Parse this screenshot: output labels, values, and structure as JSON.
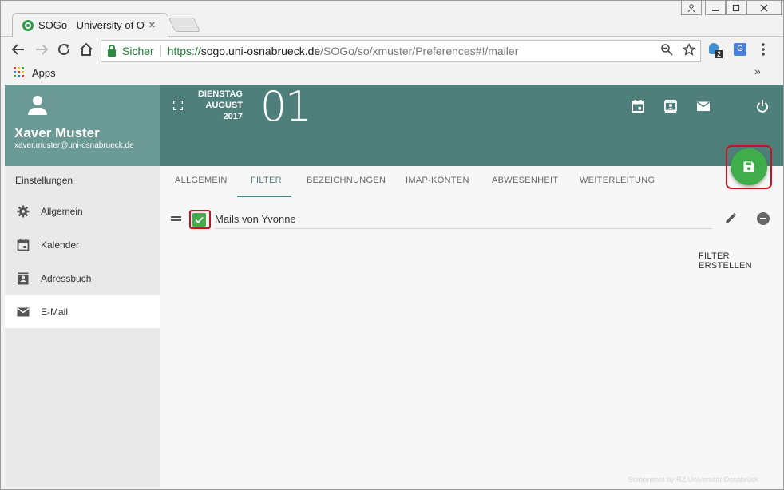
{
  "browser": {
    "tab_title": "SOGo - University of Osnabrück",
    "tab_close": "×",
    "secure_label": "Sicher",
    "url_scheme": "https://",
    "url_host": "sogo.uni-osnabrueck.de",
    "url_path": "/SOGo/so/xmuster/Preferences#!/mailer",
    "bookmark_apps": "Apps",
    "bookmark_more": "»",
    "extension_badge": "2",
    "colors": {
      "secure": "#1e7e34",
      "frame": "#f2f2f2"
    }
  },
  "user": {
    "name": "Xaver Muster",
    "email": "xaver.muster@uni-osnabrueck.de"
  },
  "sidebar": {
    "heading": "Einstellungen",
    "items": [
      {
        "label": "Allgemein",
        "icon": "gear-icon"
      },
      {
        "label": "Kalender",
        "icon": "calendar-icon"
      },
      {
        "label": "Adressbuch",
        "icon": "contacts-icon"
      },
      {
        "label": "E-Mail",
        "icon": "mail-icon",
        "active": true
      }
    ]
  },
  "date": {
    "weekday": "DIENSTAG",
    "month": "AUGUST",
    "year": "2017",
    "day": "01"
  },
  "tabs": [
    {
      "label": "ALLGEMEIN"
    },
    {
      "label": "FILTER",
      "active": true
    },
    {
      "label": "BEZEICHNUNGEN"
    },
    {
      "label": "IMAP-KONTEN"
    },
    {
      "label": "ABWESENHEIT"
    },
    {
      "label": "WEITERLEITUNG"
    }
  ],
  "filters": [
    {
      "name": "Mails von Yvonne",
      "enabled": true
    }
  ],
  "actions": {
    "create_filter": "FILTER ERSTELLEN",
    "save_icon": "save-icon"
  },
  "watermark": "Screenshot by RZ Universität Osnabrück",
  "colors": {
    "header_dark": "#4f7f7b",
    "header_light": "#6b9a96",
    "accent_green": "#3fae4a",
    "highlight_red": "#c8121f"
  }
}
